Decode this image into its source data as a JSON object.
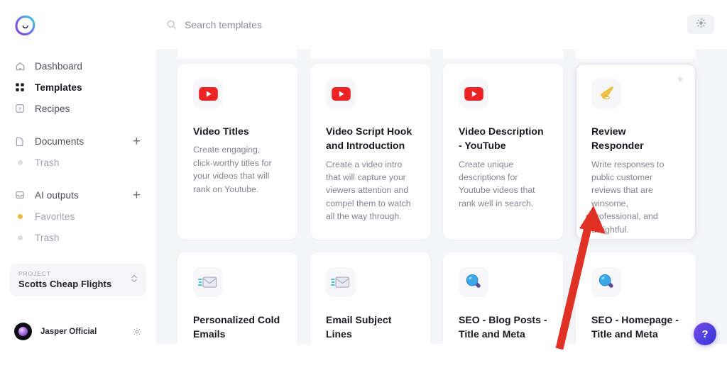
{
  "sidebar": {
    "logo_name": "jasper-logo",
    "nav": [
      {
        "id": "dashboard",
        "label": "Dashboard",
        "icon": "home-icon",
        "state": "default"
      },
      {
        "id": "templates",
        "label": "Templates",
        "icon": "grid-icon",
        "state": "active"
      },
      {
        "id": "recipes",
        "label": "Recipes",
        "icon": "recipe-icon",
        "state": "default"
      }
    ],
    "documents": {
      "label": "Documents",
      "icon": "document-icon",
      "add_label": "+"
    },
    "documents_trash": {
      "label": "Trash",
      "icon": "dot-icon"
    },
    "ai_outputs": {
      "label": "AI outputs",
      "icon": "inbox-icon",
      "add_label": "+"
    },
    "favorites": {
      "label": "Favorites",
      "icon": "dot-icon-gold"
    },
    "ai_trash": {
      "label": "Trash",
      "icon": "dot-icon"
    },
    "project": {
      "kicker": "PROJECT",
      "name": "Scotts Cheap Flights",
      "stepper_icon": "chevron-updown-icon"
    },
    "user": {
      "name": "Jasper Official",
      "avatar_name": "avatar",
      "settings_icon": "gear-icon"
    }
  },
  "topbar": {
    "search": {
      "placeholder": "Search templates",
      "value": "",
      "icon": "search-icon"
    },
    "idea_button": {
      "icon": "lightbulb-icon",
      "label": ""
    }
  },
  "main": {
    "partial_row_cards": 4,
    "cards_row1": [
      {
        "title": "Video Titles",
        "desc": "Create engaging, click-worthy titles for your videos that will rank on Youtube.",
        "icon": "youtube-icon",
        "hovered": false,
        "starred": false
      },
      {
        "title": "Video Script Hook and Introduction",
        "desc": "Create a video intro that will capture your viewers attention and compel them to watch all the way through.",
        "icon": "youtube-icon",
        "hovered": false,
        "starred": false
      },
      {
        "title": "Video Description - YouTube",
        "desc": "Create unique descriptions for Youtube videos that rank well in search.",
        "icon": "youtube-icon",
        "hovered": false,
        "starred": false
      },
      {
        "title": "Review Responder",
        "desc": "Write responses to public customer reviews that are winsome, professional, and delightful.",
        "icon": "megaphone-icon",
        "hovered": true,
        "starred": true,
        "star_glyph": "★"
      }
    ],
    "cards_row2": [
      {
        "title": "Personalized Cold Emails",
        "icon": "incoming-envelope-icon"
      },
      {
        "title": "Email Subject Lines",
        "icon": "incoming-envelope-icon"
      },
      {
        "title": "SEO - Blog Posts - Title and Meta",
        "icon": "magnifier-icon"
      },
      {
        "title": "SEO - Homepage - Title and Meta",
        "icon": "magnifier-icon"
      }
    ]
  },
  "help_button": {
    "label": "?",
    "name": "help-button"
  },
  "annotation": {
    "type": "arrow",
    "color": "#e03127"
  },
  "colors": {
    "page_bg": "#f4f5f8",
    "card_bg": "#ffffff",
    "accent_purple": "#5b46e0",
    "text_primary": "#18181f",
    "text_muted": "#83838f",
    "youtube_red": "#ed2224",
    "star_gray": "#e2e2e8",
    "arrow_red": "#e03127"
  }
}
